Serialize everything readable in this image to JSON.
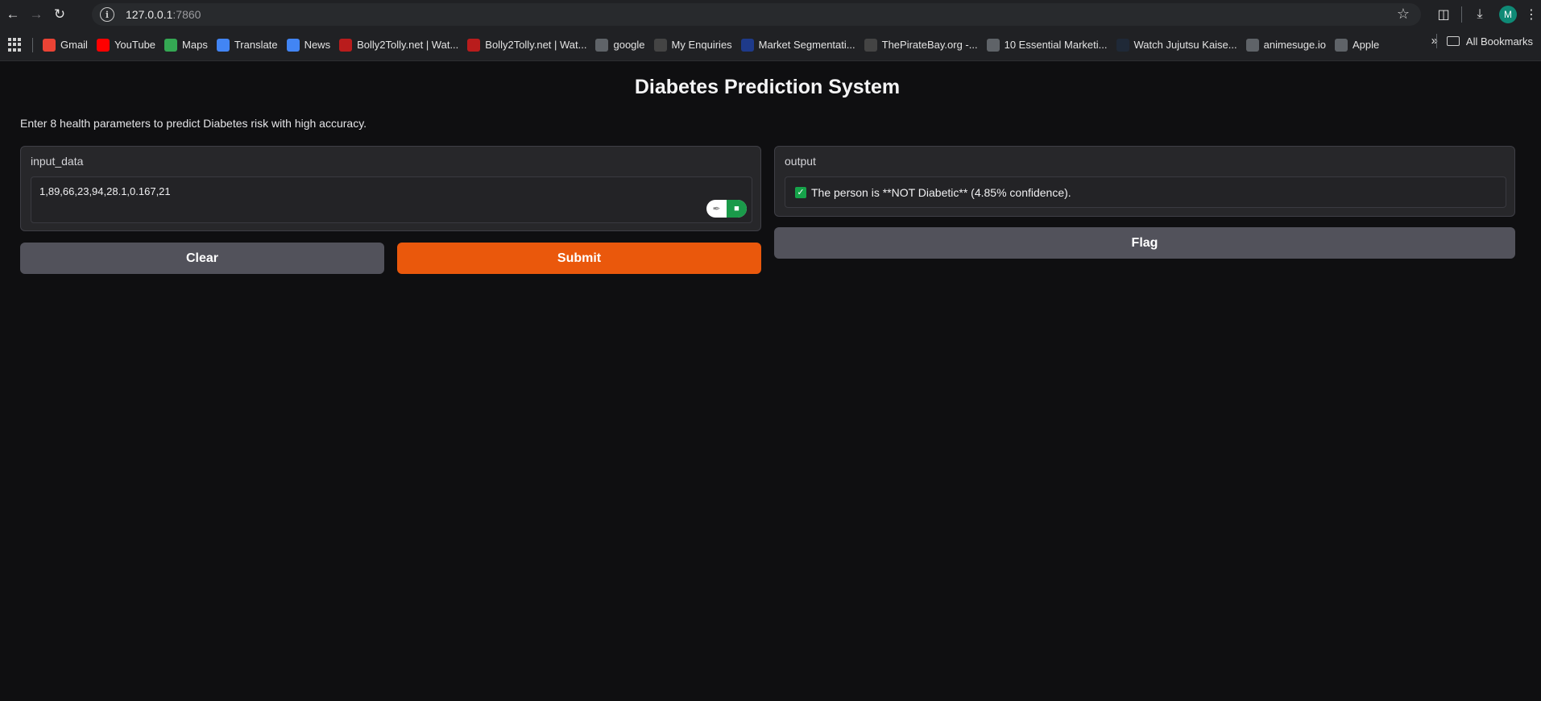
{
  "browser": {
    "url_host": "127.0.0.1",
    "url_port": ":7860",
    "avatar_initial": "M",
    "icons": {
      "back": "back-arrow-icon",
      "forward": "forward-arrow-icon",
      "reload": "reload-icon",
      "star": "star-icon",
      "extensions": "puzzle-icon",
      "download": "download-icon",
      "menu": "kebab-menu-icon"
    }
  },
  "bookmarks": {
    "items": [
      {
        "label": "Gmail",
        "icon": "gmail-icon",
        "color": "#ea4335"
      },
      {
        "label": "YouTube",
        "icon": "youtube-icon",
        "color": "#ff0000"
      },
      {
        "label": "Maps",
        "icon": "maps-icon",
        "color": "#34a853"
      },
      {
        "label": "Translate",
        "icon": "translate-icon",
        "color": "#4285f4"
      },
      {
        "label": "News",
        "icon": "news-icon",
        "color": "#4285f4"
      },
      {
        "label": "Bolly2Tolly.net | Wat...",
        "icon": "site-icon",
        "color": "#b91c1c"
      },
      {
        "label": "Bolly2Tolly.net | Wat...",
        "icon": "site-icon",
        "color": "#b91c1c"
      },
      {
        "label": "google",
        "icon": "globe-icon",
        "color": "#5f6368"
      },
      {
        "label": "My Enquiries",
        "icon": "shield-icon",
        "color": "#444"
      },
      {
        "label": "Market Segmentati...",
        "icon": "site-icon",
        "color": "#1e3a8a"
      },
      {
        "label": "ThePirateBay.org -...",
        "icon": "monitor-icon",
        "color": "#444"
      },
      {
        "label": "10 Essential Marketi...",
        "icon": "globe-icon",
        "color": "#5f6368"
      },
      {
        "label": "Watch Jujutsu Kaise...",
        "icon": "site-icon",
        "color": "#1f2937"
      },
      {
        "label": "animesuge.io",
        "icon": "globe-icon",
        "color": "#5f6368"
      },
      {
        "label": "Apple",
        "icon": "globe-icon",
        "color": "#5f6368"
      }
    ],
    "all_bookmarks_label": "All Bookmarks"
  },
  "app": {
    "title": "Diabetes Prediction System",
    "description": "Enter 8 health parameters to predict Diabetes risk with high accuracy.",
    "input_label": "input_data",
    "input_value": "1,89,66,23,94,28.1,0.167,21",
    "output_label": "output",
    "output_value": "The person is **NOT Diabetic** (4.85% confidence).",
    "clear_label": "Clear",
    "submit_label": "Submit",
    "flag_label": "Flag"
  }
}
